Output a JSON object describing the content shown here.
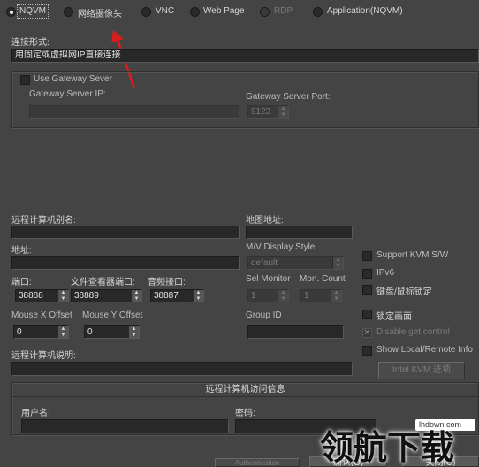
{
  "top_tabs": [
    {
      "label": "NQVM",
      "checked": true
    },
    {
      "label": "网络摄像头",
      "checked": false
    },
    {
      "label": "VNC",
      "checked": false
    },
    {
      "label": "Web Page",
      "checked": false
    },
    {
      "label": "RDP",
      "checked": false
    },
    {
      "label": "Application(NQVM)",
      "checked": false
    }
  ],
  "connection": {
    "label": "连接形式:",
    "value": "用固定或虚拟网IP直接连接"
  },
  "gateway": {
    "use_label": "Use Gateway Sever",
    "use_checked": false,
    "ip_label": "Gateway Server IP:",
    "ip_value": "",
    "port_label": "Gateway Server Port:",
    "port_value": "9123"
  },
  "remote": {
    "alias_label": "远程计算机别名:",
    "alias_value": "",
    "map_label": "地图地址:",
    "map_value": "",
    "address_label": "地址:",
    "address_value": "",
    "mv_label": "M/V Display Style",
    "mv_value": "default",
    "port_label": "端口:",
    "port_value": "38888",
    "file_port_label": "文件查看器端口:",
    "file_port_value": "38889",
    "audio_port_label": "音频接口:",
    "audio_port_value": "38887",
    "sel_monitor_label": "Sel Monitor",
    "sel_monitor_value": "1",
    "mon_count_label": "Mon. Count",
    "mon_count_value": "1",
    "mouse_x_label": "Mouse X Offset",
    "mouse_x_value": "0",
    "mouse_y_label": "Mouse Y Offset",
    "mouse_y_value": "0",
    "group_label": "Group ID",
    "group_value": "",
    "desc_label": "远程计算机说明:",
    "desc_value": ""
  },
  "options": {
    "kvm": {
      "label": "Support KVM S/W",
      "checked": false
    },
    "ipv6": {
      "label": "IPv6",
      "checked": false
    },
    "kbm_lock": {
      "label": "键盘/鼠标锁定",
      "checked": false
    },
    "lock_screen": {
      "label": "锁定画面",
      "checked": false
    },
    "disable_get_control": {
      "label": "Disable get control",
      "checked": true
    },
    "show_info": {
      "label": "Show Local/Remote Info",
      "checked": false
    },
    "intel_kvm_button": "Intel KVM 选项"
  },
  "access": {
    "title": "远程计算机访问信息",
    "user_label": "用户名:",
    "user_value": "",
    "pwd_label": "密码:",
    "pwd_value": ""
  },
  "footer": {
    "extra_button": "Authentication",
    "ok_button": "确认(O)",
    "cancel_button": "关闭(C)"
  },
  "watermark": {
    "site": "lhdown.com",
    "brand": "领航下载"
  },
  "colors": {
    "background": "#444444",
    "field": "#282828",
    "arrow": "#d81e1e"
  }
}
